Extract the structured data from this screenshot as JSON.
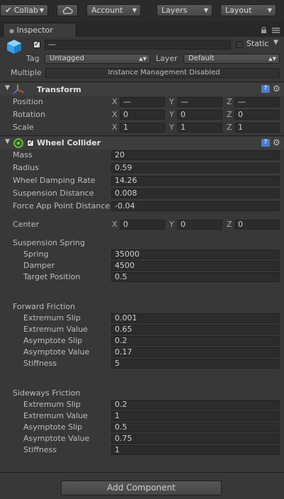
{
  "toolbar": {
    "collab": "Collab",
    "account": "Account",
    "layers": "Layers",
    "layout": "Layout"
  },
  "tabs": {
    "inspector": "Inspector"
  },
  "object": {
    "name": "—",
    "static_label": "Static",
    "tag_label": "Tag",
    "tag_value": "Untagged",
    "layer_label": "Layer",
    "layer_value": "Default",
    "multiple_label": "Multiple",
    "multiple_value": "Instance Management Disabled"
  },
  "transform": {
    "title": "Transform",
    "position_label": "Position",
    "rotation_label": "Rotation",
    "scale_label": "Scale",
    "position": {
      "x": "—",
      "y": "—",
      "z": "—"
    },
    "rotation": {
      "x": "0",
      "y": "0",
      "z": "0"
    },
    "scale": {
      "x": "1",
      "y": "1",
      "z": "1"
    }
  },
  "axes": {
    "x": "X",
    "y": "Y",
    "z": "Z"
  },
  "wheel": {
    "title": "Wheel Collider",
    "rows": [
      {
        "label": "Mass",
        "value": "20"
      },
      {
        "label": "Radius",
        "value": "0.59"
      },
      {
        "label": "Wheel Damping Rate",
        "value": "14.26"
      },
      {
        "label": "Suspension Distance",
        "value": "0.008"
      },
      {
        "label": "Force App Point Distance",
        "value": "-0.04"
      }
    ],
    "center_label": "Center",
    "center": {
      "x": "0",
      "y": "0",
      "z": "0"
    },
    "spring_title": "Suspension Spring",
    "spring": [
      {
        "label": "Spring",
        "value": "35000"
      },
      {
        "label": "Damper",
        "value": "4500"
      },
      {
        "label": "Target Position",
        "value": "0.5"
      }
    ],
    "forward_title": "Forward Friction",
    "forward": [
      {
        "label": "Extremum Slip",
        "value": "0.001"
      },
      {
        "label": "Extremum Value",
        "value": "0.65"
      },
      {
        "label": "Asymptote Slip",
        "value": "0.2"
      },
      {
        "label": "Asymptote Value",
        "value": "0.17"
      },
      {
        "label": "Stiffness",
        "value": "5"
      }
    ],
    "sideways_title": "Sideways Friction",
    "sideways": [
      {
        "label": "Extremum Slip",
        "value": "0.2"
      },
      {
        "label": "Extremum Value",
        "value": "1"
      },
      {
        "label": "Asymptote Slip",
        "value": "0.5"
      },
      {
        "label": "Asymptote Value",
        "value": "0.75"
      },
      {
        "label": "Stiffness",
        "value": "1"
      }
    ]
  },
  "add_component": "Add Component",
  "icons": [
    "checkmark-icon",
    "cloud-icon",
    "lock-icon",
    "menu-icon",
    "cube-icon",
    "transform-axes-icon",
    "wheel-collider-icon",
    "help-icon",
    "gear-icon"
  ],
  "colors": {
    "background": "#383838",
    "toolbar": "#2b2b2b",
    "field": "#2c2c2c",
    "help_blue": "#4b7ec7"
  }
}
